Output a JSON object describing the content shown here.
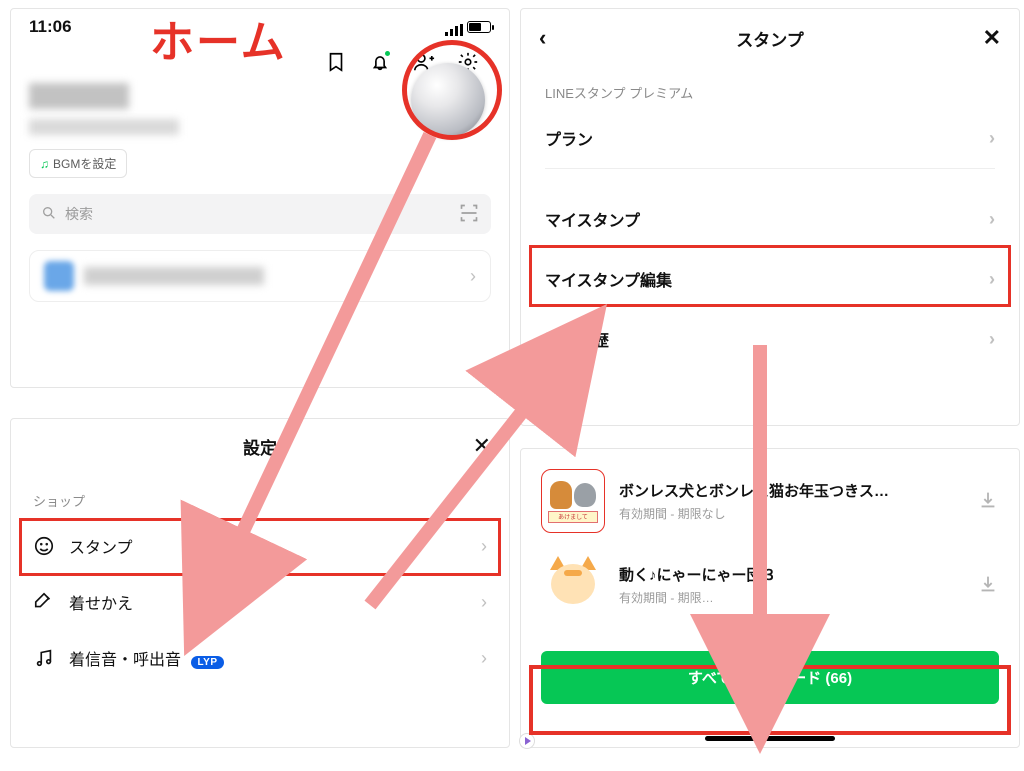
{
  "annotation": {
    "home_label": "ホーム"
  },
  "home": {
    "time": "11:06",
    "bgm_label": "BGMを設定",
    "search_placeholder": "検索"
  },
  "settings": {
    "title": "設定",
    "section_shop": "ショップ",
    "rows": {
      "stamp": "スタンプ",
      "theme": "着せかえ",
      "ringtone": "着信音・呼出音"
    },
    "lyp_badge": "LYP"
  },
  "stickers": {
    "title": "スタンプ",
    "premium_label": "LINEスタンプ プレミアム",
    "plan": "プラン",
    "my_stamps": "マイスタンプ",
    "edit_my_stamps": "マイスタンプ編集",
    "purchase_history": "購入履歴"
  },
  "downloads": {
    "items": [
      {
        "title": "ボンレス犬とボンレス猫お年玉つきス…",
        "subtitle": "有効期間 - 期限なし"
      },
      {
        "title": "動く♪にゃーにゃー団３",
        "subtitle": "有効期間 - 期限…"
      }
    ],
    "button": "すべてダウンロード (66)"
  }
}
